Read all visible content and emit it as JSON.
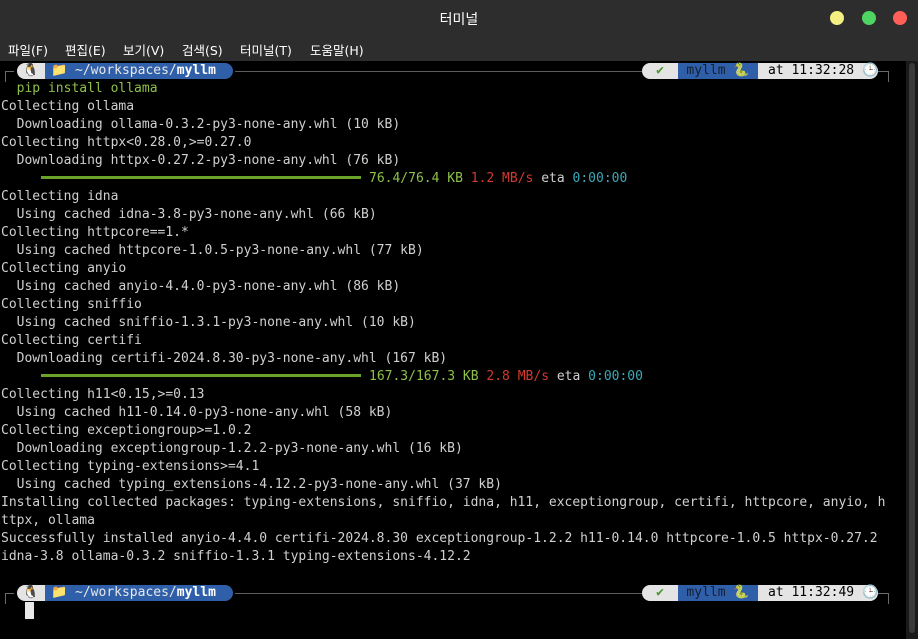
{
  "window": {
    "title": "터미널",
    "menu": [
      "파일(F)",
      "편집(E)",
      "보기(V)",
      "검색(S)",
      "터미널(T)",
      "도움말(H)"
    ]
  },
  "prompt1": {
    "os_icon": "🐧",
    "folder_icon": "📁",
    "path_prefix": "~/workspaces/",
    "path_dir": "myllm",
    "status_icon": "✔",
    "env": "myllm",
    "env_icon": "🐍",
    "time_prefix": "at",
    "time": "11:32:28",
    "clock_icon": "🕒",
    "command": "  pip install ollama"
  },
  "output": [
    "Collecting ollama",
    "  Downloading ollama-0.3.2-py3-none-any.whl (10 kB)",
    "Collecting httpx<0.28.0,>=0.27.0",
    "  Downloading httpx-0.27.2-py3-none-any.whl (76 kB)",
    "",
    "Collecting idna",
    "  Using cached idna-3.8-py3-none-any.whl (66 kB)",
    "Collecting httpcore==1.*",
    "  Using cached httpcore-1.0.5-py3-none-any.whl (77 kB)",
    "Collecting anyio",
    "  Using cached anyio-4.4.0-py3-none-any.whl (86 kB)",
    "Collecting sniffio",
    "  Using cached sniffio-1.3.1-py3-none-any.whl (10 kB)",
    "Collecting certifi",
    "  Downloading certifi-2024.8.30-py3-none-any.whl (167 kB)",
    "",
    "Collecting h11<0.15,>=0.13",
    "  Using cached h11-0.14.0-py3-none-any.whl (58 kB)",
    "Collecting exceptiongroup>=1.0.2",
    "  Downloading exceptiongroup-1.2.2-py3-none-any.whl (16 kB)",
    "Collecting typing-extensions>=4.1",
    "  Using cached typing_extensions-4.12.2-py3-none-any.whl (37 kB)",
    "Installing collected packages: typing-extensions, sniffio, idna, h11, exceptiongroup, certifi, httpcore, anyio, h",
    "ttpx, ollama",
    "Successfully installed anyio-4.4.0 certifi-2024.8.30 exceptiongroup-1.2.2 h11-0.14.0 httpcore-1.0.5 httpx-0.27.2",
    "idna-3.8 ollama-0.3.2 sniffio-1.3.1 typing-extensions-4.12.2"
  ],
  "progress1": {
    "size": "76.4/76.4 KB",
    "speed": "1.2 MB/s",
    "eta_label": "eta",
    "eta": "0:00:00",
    "fraction": 1.0
  },
  "progress2": {
    "size": "167.3/167.3 KB",
    "speed": "2.8 MB/s",
    "eta_label": "eta",
    "eta": "0:00:00",
    "fraction": 1.0
  },
  "prompt2": {
    "os_icon": "🐧",
    "folder_icon": "📁",
    "path_prefix": "~/workspaces/",
    "path_dir": "myllm",
    "status_icon": "✔",
    "env": "myllm",
    "env_icon": "🐍",
    "time_prefix": "at",
    "time": "11:32:49",
    "clock_icon": "🕒"
  },
  "colors": {
    "terminal_bg": "#000000",
    "text": "#d0d0d0",
    "prompt_blue": "#2f5fa8",
    "progress_green": "#8ec04a",
    "speed_red": "#d03a30",
    "eta_cyan": "#3aa8b8"
  }
}
